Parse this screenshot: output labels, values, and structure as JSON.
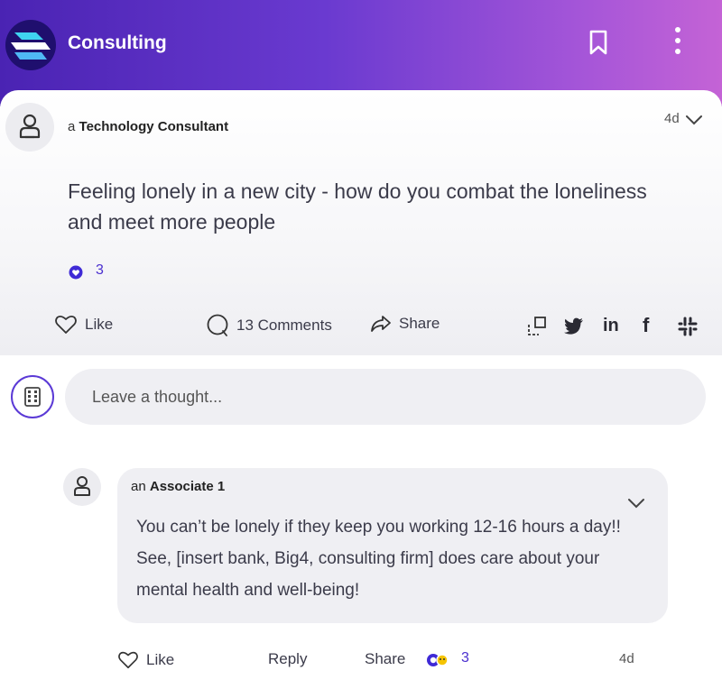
{
  "header": {
    "title": "Consulting",
    "icons": {
      "logo": "app-logo",
      "bookmark": "bookmark-icon",
      "menu": "more-vertical-icon"
    },
    "gradient": [
      "#4a23b3",
      "#c463d6"
    ]
  },
  "post": {
    "author_prefix": "a",
    "author_name": "Technology Consultant",
    "time": "4d",
    "text": "Feeling lonely in a new city - how do you combat the loneliness and meet more people",
    "reaction_count": "3",
    "actions": {
      "like": "Like",
      "comments": "13 Comments",
      "share": "Share"
    },
    "share_icons": [
      "copy-link-icon",
      "twitter-icon",
      "linkedin-icon",
      "facebook-icon",
      "slack-icon"
    ]
  },
  "composer": {
    "placeholder": "Leave a thought..."
  },
  "comment": {
    "author_prefix": "an",
    "author_name": "Associate 1",
    "text": "You can’t be lonely if they keep you working 12-16 hours a day!! See, [insert bank, Big4, consulting firm] does care about your mental health and well-being!",
    "actions": {
      "like": "Like",
      "reply": "Reply",
      "share": "Share"
    },
    "reaction_count": "3",
    "time": "4d"
  },
  "colors": {
    "accent": "#4a2fcf",
    "text": "#3b3b4a",
    "bubble": "#efeff3"
  }
}
